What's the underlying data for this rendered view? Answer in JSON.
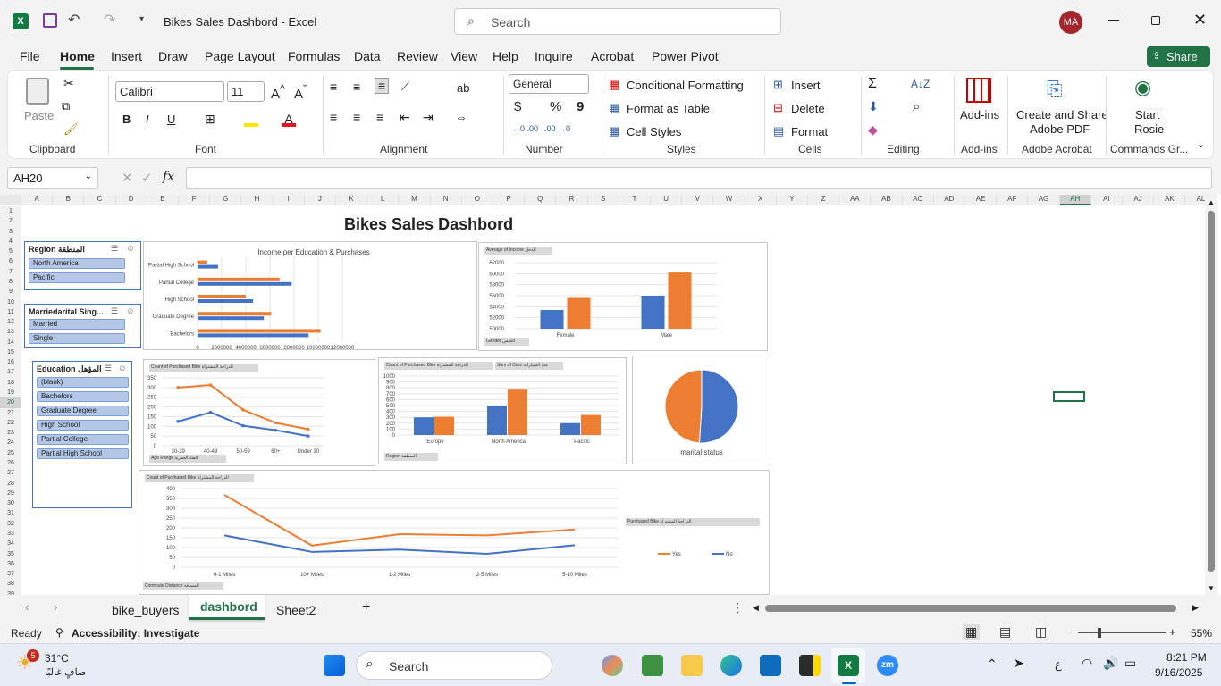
{
  "window": {
    "title": "Bikes Sales Dashbord  -  Excel",
    "search_placeholder": "Search",
    "user_initials": "MA"
  },
  "menu": {
    "tabs": [
      "File",
      "Home",
      "Insert",
      "Draw",
      "Page Layout",
      "Formulas",
      "Data",
      "Review",
      "View",
      "Help",
      "Inquire",
      "Acrobat",
      "Power Pivot"
    ],
    "active": "Home",
    "share": "Share"
  },
  "ribbon": {
    "clipboard": {
      "paste": "Paste",
      "label": "Clipboard"
    },
    "font": {
      "name": "Calibri",
      "size": "11",
      "label": "Font",
      "bold": "B",
      "italic": "I",
      "underline": "U"
    },
    "alignment": {
      "label": "Alignment"
    },
    "number": {
      "format": "General",
      "label": "Number",
      "currency": "$",
      "percent": "%",
      "comma": "9"
    },
    "styles": {
      "cond": "Conditional Formatting",
      "table": "Format as Table",
      "cell": "Cell Styles",
      "label": "Styles"
    },
    "cells": {
      "insert": "Insert",
      "delete": "Delete",
      "format": "Format",
      "label": "Cells"
    },
    "editing": {
      "label": "Editing"
    },
    "addins": {
      "btn": "Add-ins",
      "label": "Add-ins"
    },
    "acrobat": {
      "btn1": "Create and Share",
      "btn2": "Adobe PDF",
      "label": "Adobe Acrobat"
    },
    "rosie": {
      "btn1": "Start",
      "btn2": "Rosie",
      "label": "Commands Gr..."
    }
  },
  "formula_bar": {
    "name_box": "AH20",
    "fx": "fx",
    "value": ""
  },
  "columns": [
    "A",
    "B",
    "C",
    "D",
    "E",
    "F",
    "G",
    "H",
    "I",
    "J",
    "K",
    "L",
    "M",
    "N",
    "O",
    "P",
    "Q",
    "R",
    "S",
    "T",
    "U",
    "V",
    "W",
    "X",
    "Y",
    "Z",
    "AA",
    "AB",
    "AC",
    "AD",
    "AE",
    "AF",
    "AG",
    "AH",
    "AI",
    "AJ",
    "AK",
    "AL"
  ],
  "rows": [
    "1",
    "2",
    "3",
    "4",
    "5",
    "6",
    "7",
    "8",
    "9",
    "10",
    "11",
    "12",
    "13",
    "14",
    "15",
    "16",
    "17",
    "18",
    "19",
    "20",
    "21",
    "22",
    "23",
    "24",
    "25",
    "26",
    "27",
    "28",
    "29",
    "30",
    "31",
    "32",
    "33",
    "34",
    "35",
    "36",
    "37",
    "38",
    "39"
  ],
  "dashboard": {
    "title": "Bikes Sales Dashbord"
  },
  "slicers": {
    "region": {
      "title": "Region المنطقة",
      "items": [
        "North America",
        "Pacific"
      ]
    },
    "marital": {
      "title": "Marriedarital Sing...",
      "items": [
        "Married",
        "Single"
      ]
    },
    "education": {
      "title": "Education المؤهل",
      "items": [
        "(blank)",
        "Bachelors",
        "Graduate Degree",
        "High School",
        "Partial College",
        "Partial High School"
      ]
    }
  },
  "colors": {
    "orange": "#ed7d31",
    "blue": "#4472c4",
    "accent": "#217346"
  },
  "chart_data": [
    {
      "type": "bar",
      "orientation": "horizontal",
      "title": "Income per Education & Purchases",
      "categories": [
        "Partial High School",
        "Partial College",
        "High School",
        "Graduate Degree",
        "Bachelors"
      ],
      "series": [
        {
          "values": [
            800000,
            6800000,
            4000000,
            6100000,
            10200000
          ]
        },
        {
          "values": [
            1700000,
            7800000,
            4600000,
            5500000,
            9200000
          ]
        }
      ],
      "xlim": [
        0,
        12000000
      ],
      "xticks": [
        "0",
        "2000000",
        "4000000",
        "6000000",
        "8000000",
        "10000000",
        "12000000"
      ]
    },
    {
      "type": "bar",
      "title": "Average of Income",
      "field_button": "Average of Income الدخل",
      "filter_button": "Gender الجنس",
      "categories": [
        "Female",
        "Male"
      ],
      "series": [
        {
          "values": [
            53400,
            56000
          ]
        },
        {
          "values": [
            55600,
            60200
          ]
        }
      ],
      "ylim": [
        50000,
        62000
      ],
      "yticks": [
        "50000",
        "52000",
        "54000",
        "56000",
        "58000",
        "60000",
        "62000"
      ]
    },
    {
      "type": "line",
      "field_button": "Count of Purchased Bike الدراجة المشتراة",
      "filter_button": "Age Range الفئة العمرية",
      "categories": [
        "30-39",
        "40-49",
        "50-59",
        "60+",
        "Under 30"
      ],
      "series": [
        {
          "values": [
            300,
            313,
            185,
            118,
            85
          ]
        },
        {
          "values": [
            125,
            172,
            103,
            80,
            50
          ]
        }
      ],
      "ylim": [
        0,
        350
      ],
      "yticks": [
        "0",
        "50",
        "100",
        "150",
        "200",
        "250",
        "300",
        "350"
      ]
    },
    {
      "type": "bar",
      "field_button": "Count of Purchased Bike الدراجة المشتراة",
      "field_button2": "Sum of Cars عدد السيارات",
      "filter_button": "Region المنطقة",
      "categories": [
        "Europe",
        "North America",
        "Pacific"
      ],
      "series": [
        {
          "values": [
            300,
            500,
            200
          ]
        },
        {
          "values": [
            310,
            770,
            340
          ]
        }
      ],
      "ylim": [
        0,
        1000
      ],
      "yticks": [
        "0",
        "100",
        "200",
        "300",
        "400",
        "500",
        "600",
        "700",
        "800",
        "900",
        "1000"
      ]
    },
    {
      "type": "pie",
      "title": "marital status",
      "slices": [
        {
          "value": 51
        },
        {
          "value": 49
        }
      ]
    },
    {
      "type": "line",
      "field_button": "Count of Purchased Bike الدراجة المشتراة",
      "filter_button": "Commute Distance المسافة",
      "legend_title": "Purchased Bike الدراجة المشتراة",
      "categories": [
        "0-1 Miles",
        "10+ Miles",
        "1-2 Miles",
        "2-5 Miles",
        "5-10 Miles"
      ],
      "series": [
        {
          "name": "Yes",
          "values": [
            368,
            110,
            168,
            162,
            192
          ]
        },
        {
          "name": "No",
          "values": [
            162,
            78,
            90,
            68,
            112
          ]
        }
      ],
      "ylim": [
        0,
        400
      ],
      "yticks": [
        "0",
        "50",
        "100",
        "150",
        "200",
        "250",
        "300",
        "350",
        "400"
      ]
    }
  ],
  "sheets": {
    "tabs": [
      "bike_buyers",
      "dashbord",
      "Sheet2"
    ],
    "active": "dashbord"
  },
  "status": {
    "ready": "Ready",
    "accessibility": "Accessibility: Investigate",
    "zoom": "55%"
  },
  "taskbar": {
    "temp": "31°C",
    "weather": "صافٍ غالبًا",
    "badge": "5",
    "search": "Search",
    "lang": "ع",
    "time": "8:21 PM",
    "date": "9/16/2025"
  }
}
